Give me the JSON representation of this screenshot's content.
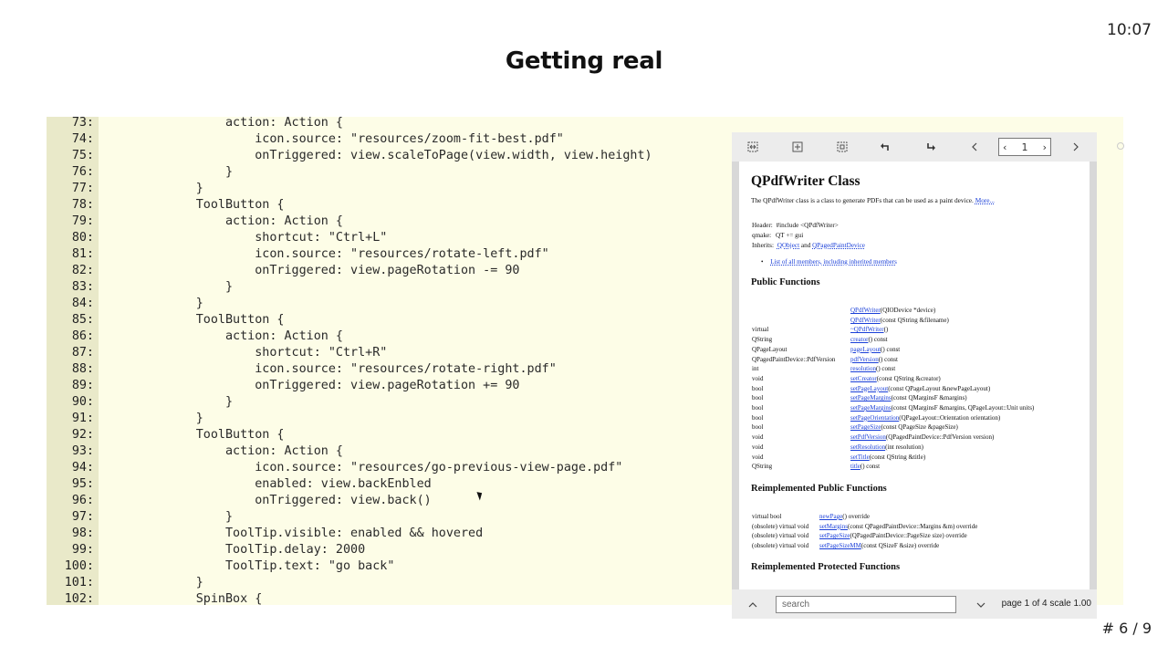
{
  "slide": {
    "time": "10:07",
    "title": "Getting real",
    "counter": "# 6 / 9"
  },
  "code": {
    "lines": [
      {
        "n": "73:",
        "t": "                action: Action {"
      },
      {
        "n": "74:",
        "t": "                    icon.source: \"resources/zoom-fit-best.pdf\""
      },
      {
        "n": "75:",
        "t": "                    onTriggered: view.scaleToPage(view.width, view.height)"
      },
      {
        "n": "76:",
        "t": "                }"
      },
      {
        "n": "77:",
        "t": "            }"
      },
      {
        "n": "78:",
        "t": "            ToolButton {"
      },
      {
        "n": "79:",
        "t": "                action: Action {"
      },
      {
        "n": "80:",
        "t": "                    shortcut: \"Ctrl+L\""
      },
      {
        "n": "81:",
        "t": "                    icon.source: \"resources/rotate-left.pdf\""
      },
      {
        "n": "82:",
        "t": "                    onTriggered: view.pageRotation -= 90"
      },
      {
        "n": "83:",
        "t": "                }"
      },
      {
        "n": "84:",
        "t": "            }"
      },
      {
        "n": "85:",
        "t": "            ToolButton {"
      },
      {
        "n": "86:",
        "t": "                action: Action {"
      },
      {
        "n": "87:",
        "t": "                    shortcut: \"Ctrl+R\""
      },
      {
        "n": "88:",
        "t": "                    icon.source: \"resources/rotate-right.pdf\""
      },
      {
        "n": "89:",
        "t": "                    onTriggered: view.pageRotation += 90"
      },
      {
        "n": "90:",
        "t": "                }"
      },
      {
        "n": "91:",
        "t": "            }"
      },
      {
        "n": "92:",
        "t": "            ToolButton {"
      },
      {
        "n": "93:",
        "t": "                action: Action {"
      },
      {
        "n": "94:",
        "t": "                    icon.source: \"resources/go-previous-view-page.pdf\""
      },
      {
        "n": "95:",
        "t": "                    enabled: view.backEnbled"
      },
      {
        "n": "96:",
        "t": "                    onTriggered: view.back()"
      },
      {
        "n": "97:",
        "t": "                }"
      },
      {
        "n": "98:",
        "t": "                ToolTip.visible: enabled && hovered"
      },
      {
        "n": "99:",
        "t": "                ToolTip.delay: 2000"
      },
      {
        "n": "100:",
        "t": "                ToolTip.text: \"go back\""
      },
      {
        "n": "101:",
        "t": "            }"
      },
      {
        "n": "102:",
        "t": "            SpinBox {"
      }
    ]
  },
  "viewer": {
    "toolbar": {
      "icons": [
        "zoom-fit-width-icon",
        "zoom-fit-page-icon",
        "zoom-fit-best-icon",
        "rotate-left-icon",
        "rotate-right-icon",
        "go-back-icon"
      ],
      "page_value": "1"
    },
    "footer": {
      "search_placeholder": "search",
      "page_info": "page 1 of 4 scale 1.00"
    },
    "doc": {
      "title": "QPdfWriter Class",
      "intro": "The QPdfWriter class is a class to generate PDFs that can be used as a paint device.",
      "more": "More...",
      "header_label": "Header:",
      "header_value": "#include <QPdfWriter>",
      "qmake_label": "qmake:",
      "qmake_value": "QT += gui",
      "inherits_label": "Inherits:",
      "inherits_a": "QObject",
      "inherits_and": "and",
      "inherits_b": "QPagedPaintDevice",
      "members_link": "List of all members, including inherited members",
      "public_functions_heading": "Public Functions",
      "public_functions": [
        {
          "type": "",
          "name": "QPdfWriter",
          "rest": "(QIODevice *device)"
        },
        {
          "type": "",
          "name": "QPdfWriter",
          "rest": "(const QString &filename)"
        },
        {
          "type": "virtual",
          "name": "~QPdfWriter",
          "rest": "()"
        },
        {
          "type": "QString",
          "name": "creator",
          "rest": "() const"
        },
        {
          "type": "QPageLayout",
          "name": "pageLayout",
          "rest": "() const"
        },
        {
          "type": "QPagedPaintDevice::PdfVersion",
          "name": "pdfVersion",
          "rest": "() const"
        },
        {
          "type": "int",
          "name": "resolution",
          "rest": "() const"
        },
        {
          "type": "void",
          "name": "setCreator",
          "rest": "(const QString &creator)"
        },
        {
          "type": "bool",
          "name": "setPageLayout",
          "rest": "(const QPageLayout &newPageLayout)"
        },
        {
          "type": "bool",
          "name": "setPageMargins",
          "rest": "(const QMarginsF &margins)"
        },
        {
          "type": "bool",
          "name": "setPageMargins",
          "rest": "(const QMarginsF &margins, QPageLayout::Unit units)"
        },
        {
          "type": "bool",
          "name": "setPageOrientation",
          "rest": "(QPageLayout::Orientation orientation)"
        },
        {
          "type": "bool",
          "name": "setPageSize",
          "rest": "(const QPageSize &pageSize)"
        },
        {
          "type": "void",
          "name": "setPdfVersion",
          "rest": "(QPagedPaintDevice::PdfVersion version)"
        },
        {
          "type": "void",
          "name": "setResolution",
          "rest": "(int resolution)"
        },
        {
          "type": "void",
          "name": "setTitle",
          "rest": "(const QString &title)"
        },
        {
          "type": "QString",
          "name": "title",
          "rest": "() const"
        }
      ],
      "reimpl_public_heading": "Reimplemented Public Functions",
      "reimpl_public": [
        {
          "type": "virtual bool",
          "name": "newPage",
          "rest": "() override"
        },
        {
          "type": "(obsolete) virtual void",
          "name": "setMargins",
          "rest": "(const QPagedPaintDevice::Margins &m) override"
        },
        {
          "type": "(obsolete) virtual void",
          "name": "setPageSize",
          "rest": "(QPagedPaintDevice::PageSize size) override"
        },
        {
          "type": "(obsolete) virtual void",
          "name": "setPageSizeMM",
          "rest": "(const QSizeF &size) override"
        }
      ],
      "reimpl_protected_heading": "Reimplemented Protected Functions"
    }
  }
}
